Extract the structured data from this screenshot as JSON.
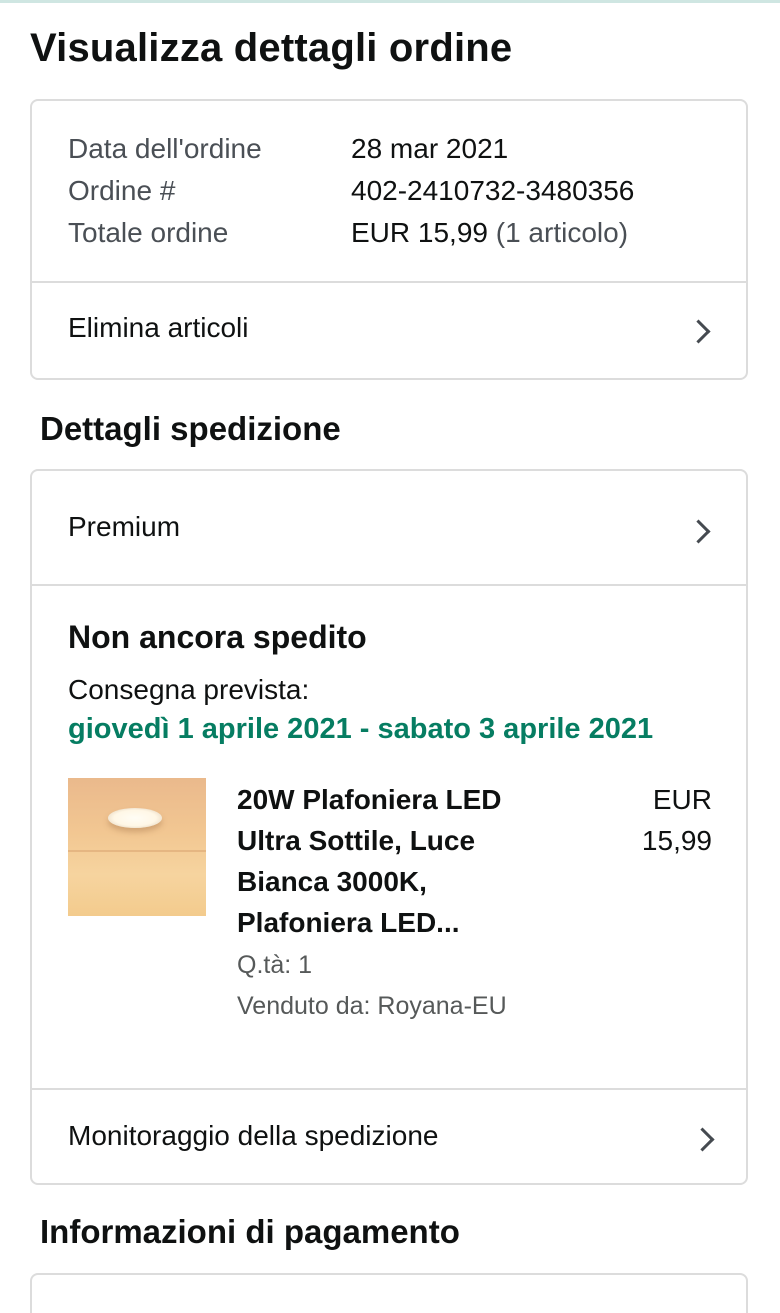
{
  "page": {
    "title": "Visualizza dettagli ordine"
  },
  "order_summary": {
    "date_label": "Data dell'ordine",
    "date_value": "28 mar 2021",
    "number_label": "Ordine #",
    "number_value": "402-2410732-3480356",
    "total_label": "Totale ordine",
    "total_value": "EUR 15,99",
    "total_items": "(1 articolo)",
    "delete_items_label": "Elimina articoli"
  },
  "shipping": {
    "section_title": "Dettagli spedizione",
    "shipping_option": "Premium",
    "status": "Non ancora spedito",
    "delivery_label": "Consegna prevista:",
    "delivery_range": "giovedì 1 aprile 2021 - sabato 3 aprile 2021",
    "product": {
      "name": "20W Plafoniera LED Ultra Sottile, Luce Bianca 3000K, Plafoniera LED...",
      "price_currency": "EUR",
      "price_amount": "15,99",
      "quantity": "Q.tà: 1",
      "seller": "Venduto da: Royana-EU"
    },
    "tracking_label": "Monitoraggio della spedizione"
  },
  "payment": {
    "section_title": "Informazioni di pagamento"
  },
  "colors": {
    "delivery_green": "#067d62",
    "border": "#dcdcdc",
    "text": "#0f1111",
    "muted": "#4a4f55"
  },
  "icons": {
    "chevron": "chevron-right-icon"
  }
}
